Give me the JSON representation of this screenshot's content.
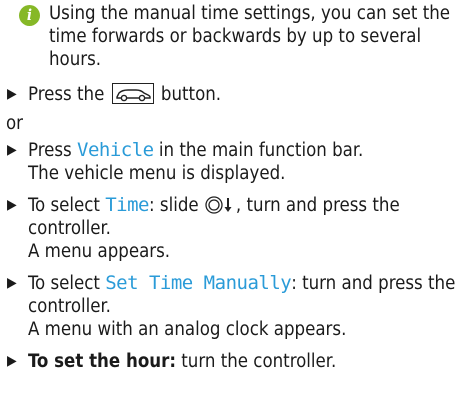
{
  "note": {
    "icon": "info-icon",
    "text": "Using the manual time settings, you can set the time forwards or backwards by up to several hours."
  },
  "steps": [
    {
      "pre": "Press the ",
      "button_icon": "vehicle-button-icon",
      "post": " button."
    },
    {
      "or": "or"
    },
    {
      "pre": "Press ",
      "menu": "Vehicle",
      "post": " in the main function bar.",
      "result": "The vehicle menu is displayed."
    },
    {
      "pre": "To select ",
      "menu": "Time",
      "post1": ": slide ",
      "controller_icon": "controller-slide-down-icon",
      "post2": ", turn and press the controller.",
      "result": "A menu appears."
    },
    {
      "pre": "To select ",
      "menu": "Set Time Manually",
      "post": ": turn and press the controller.",
      "result": "A menu with an analog clock appears."
    },
    {
      "strong": "To set the hour:",
      "post": " turn the controller."
    }
  ],
  "colors": {
    "accent_blue": "#2a9bd8",
    "info_green": "#86b827"
  }
}
